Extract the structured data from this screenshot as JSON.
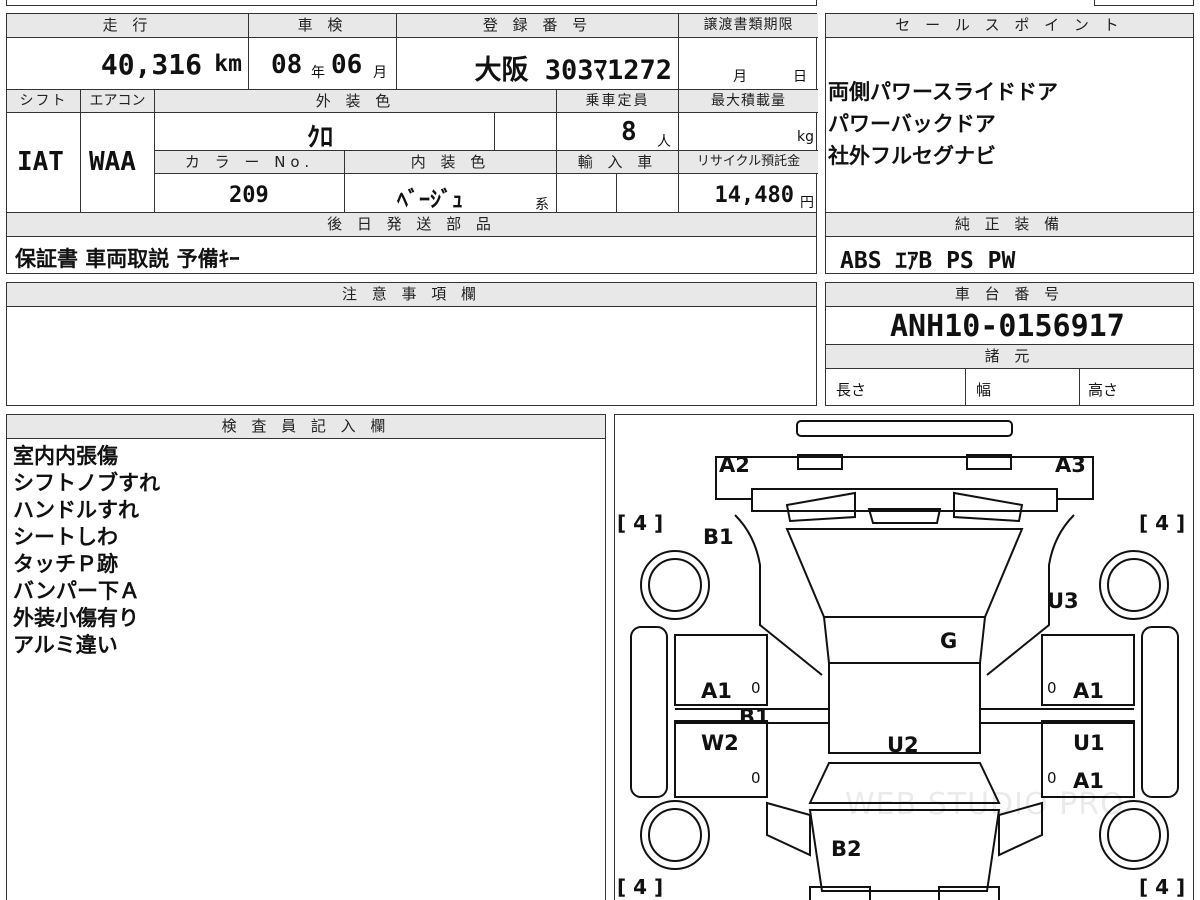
{
  "vehicle": {
    "headers": {
      "mileage": "走 行",
      "inspection": "車 検",
      "registration": "登 録 番 号",
      "transfer_deadline": "譲渡書類期限",
      "shift": "シフト",
      "aircon": "エアコン",
      "exterior_color": "外 装 色",
      "capacity": "乗車定員",
      "max_load": "最大積載量",
      "color_no": "カ ラ ー No.",
      "interior_color": "内 装 色",
      "import": "輸 入 車",
      "recycle": "リサイクル預託金"
    },
    "mileage_value": "40,316",
    "mileage_unit": "km",
    "inspection_year": "08",
    "inspection_year_unit": "年",
    "inspection_month": "06",
    "inspection_month_unit": "月",
    "registration_value": "大阪 303ﾏ1272",
    "transfer_month_unit": "月",
    "transfer_day_unit": "日",
    "shift_value": "IAT",
    "aircon_value": "WAA",
    "exterior_color_value": "ｸﾛ",
    "capacity_value": "8",
    "capacity_unit": "人",
    "max_load_unit": "kg",
    "color_no_value": "209",
    "interior_color_value": "ﾍﾞｰｼﾞｭ",
    "interior_color_suffix": "系",
    "recycle_value": "14,480",
    "recycle_unit": "円"
  },
  "later_parts": {
    "header": "後 日 発 送 部 品",
    "value": "保証書 車両取説 予備ｷｰ"
  },
  "sales_points": {
    "header": "セ ー ル ス ポ イ ン ト",
    "items": [
      "両側パワースライドドア",
      "パワーバックドア",
      "社外フルセグナビ"
    ]
  },
  "genuine_equipment": {
    "header": "純 正 装 備",
    "value": "ABS ｴｱB PS PW"
  },
  "caution": {
    "header": "注 意 事 項 欄"
  },
  "chassis": {
    "header": "車 台 番 号",
    "value": "ANH10-0156917"
  },
  "specs": {
    "header": "諸 元",
    "length": "長さ",
    "width": "幅",
    "height": "高さ"
  },
  "inspector": {
    "header": "検 査 員 記 入 欄",
    "notes": [
      "室内内張傷",
      "シフトノブすれ",
      "ハンドルすれ",
      "シートしわ",
      "タッチＰ跡",
      "バンパー下Ａ",
      "外装小傷有り",
      "アルミ違い"
    ]
  },
  "diagram": {
    "tire_tl": "[ 4 ]",
    "tire_tr": "[ 4 ]",
    "tire_bl": "[ 4 ]",
    "tire_br": "[ 4 ]",
    "labels": {
      "a2": "A2",
      "a3": "A3",
      "b1_front": "B1",
      "u3": "U3",
      "g": "G",
      "a1_left": "A1",
      "b1_mid": "B1",
      "w2": "W2",
      "u2": "U2",
      "a1_right": "A1",
      "u1": "U1",
      "a1_right_low": "A1",
      "b2": "B2"
    },
    "zero_marks": [
      "0",
      "0",
      "0",
      "0"
    ],
    "watermark": "WEB STUDIO PRO"
  },
  "colors": {
    "border": "#333333",
    "header_bg": "#e8e8e8"
  }
}
